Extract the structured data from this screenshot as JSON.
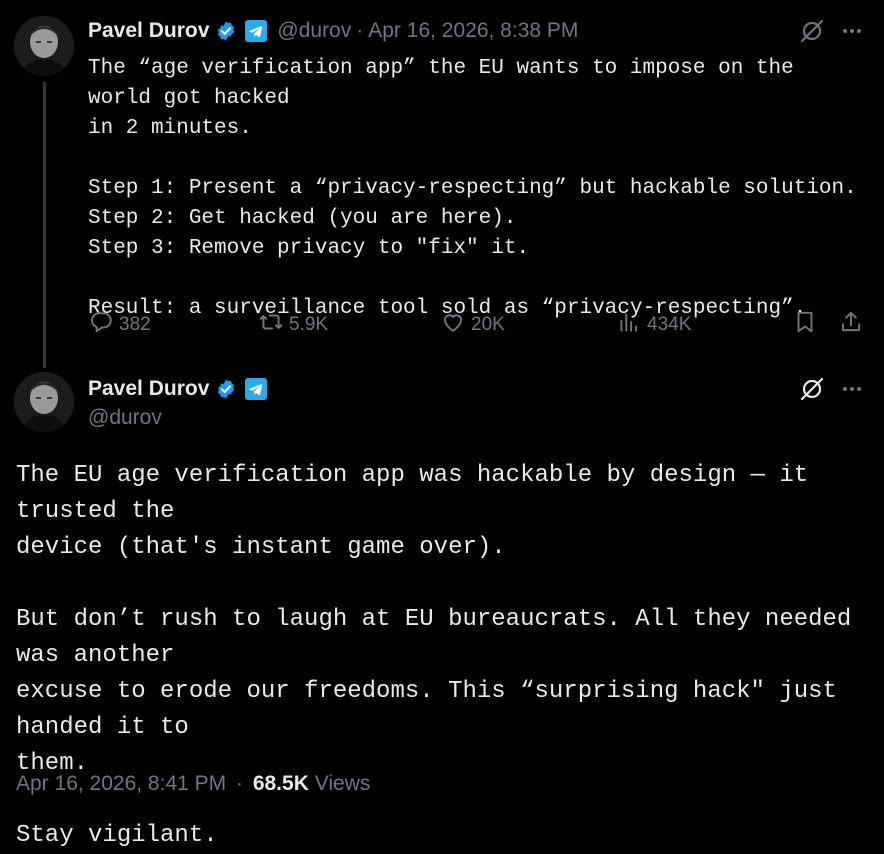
{
  "tweet1": {
    "author_name": "Pavel Durov",
    "handle": "@durov",
    "separator": "·",
    "timestamp": "Apr 16, 2026, 8:38 PM",
    "text": "The “age verification app” the EU wants to impose on the world got hacked\nin 2 minutes.\n\nStep 1: Present a “privacy-respecting” but hackable solution.\nStep 2: Get hacked (you are here).\nStep 3: Remove privacy to \"fix\" it.\n\nResult: a surveillance tool sold as “privacy-respecting”.",
    "stats": {
      "replies": "382",
      "reposts": "5.9K",
      "likes": "20K",
      "views": "434K"
    }
  },
  "tweet2": {
    "author_name": "Pavel Durov",
    "handle": "@durov",
    "text": "The EU age verification app was hackable by design — it trusted the\ndevice (that's instant game over).\n\nBut don’t rush to laugh at EU bureaucrats. All they needed was another\nexcuse to erode our freedoms. This “surprising hack\" just handed it to\nthem.\n\nStay vigilant.",
    "timestamp": "Apr 16, 2026, 8:41 PM",
    "separator": "·",
    "views_count": "68.5K",
    "views_label": "Views"
  },
  "icons": {
    "verified": "verified-badge-icon",
    "telegram": "telegram-icon",
    "grok": "grok-icon",
    "more": "more-icon",
    "reply": "reply-icon",
    "repost": "repost-icon",
    "like": "like-icon",
    "views": "views-icon",
    "bookmark": "bookmark-icon",
    "share": "share-icon"
  },
  "colors": {
    "background": "#000000",
    "text_primary": "#e7e9ea",
    "text_secondary": "#71767b",
    "verified_blue": "#1d9bf0",
    "telegram_blue": "#2aabee",
    "thread_line": "#333639"
  }
}
